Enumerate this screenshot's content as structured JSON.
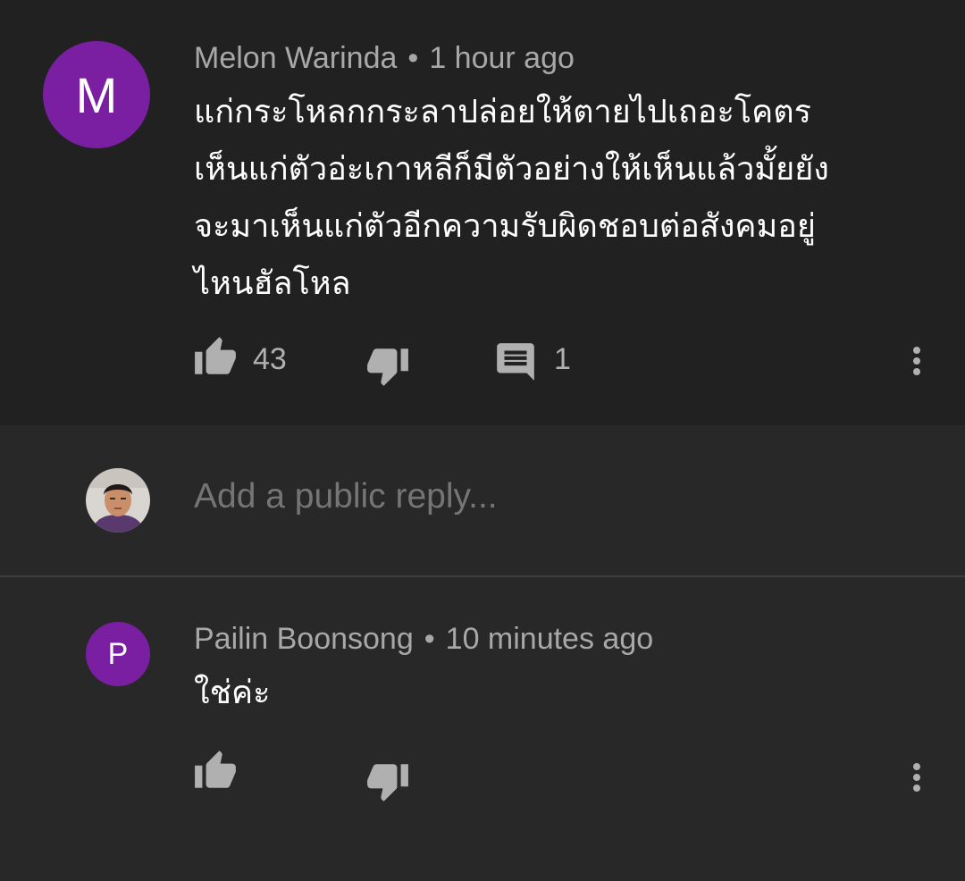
{
  "comment1": {
    "avatar_letter": "M",
    "avatar_color": "#7b1fa2",
    "author": "Melon Warinda",
    "separator": "•",
    "time": "1 hour ago",
    "text_lines": [
      "แก่กระโหลกกระลาปล่อยให้ตายไปเถอะโคตร",
      "เห็นแก่ตัวอ่ะเกาหลีก็มีตัวอย่างให้เห็นแล้วมั้ยยัง",
      "จะมาเห็นแก่ตัวอีกความรับผิดชอบต่อสังคมอยู่",
      "ไหนฮัลโหล"
    ],
    "like_icon": "thumb-up-icon",
    "like_count": "43",
    "dislike_icon": "thumb-down-icon",
    "reply_icon": "comment-icon",
    "reply_count": "1",
    "menu_icon": "more-vert-icon"
  },
  "reply_box": {
    "placeholder": "Add a public reply...",
    "user_avatar": "user-avatar-photo"
  },
  "comment2": {
    "avatar_letter": "P",
    "avatar_color": "#7b1fa2",
    "author": "Pailin Boonsong",
    "separator": "•",
    "time": "10 minutes ago",
    "text_lines": [
      "ใช่ค่ะ"
    ],
    "like_icon": "thumb-up-icon",
    "dislike_icon": "thumb-down-icon",
    "menu_icon": "more-vert-icon"
  },
  "colors": {
    "top_background": "#212121",
    "background": "#282828",
    "meta_text": "#a8a8a8",
    "icon": "#b0b0b0",
    "avatar_purple": "#7b1fa2"
  }
}
